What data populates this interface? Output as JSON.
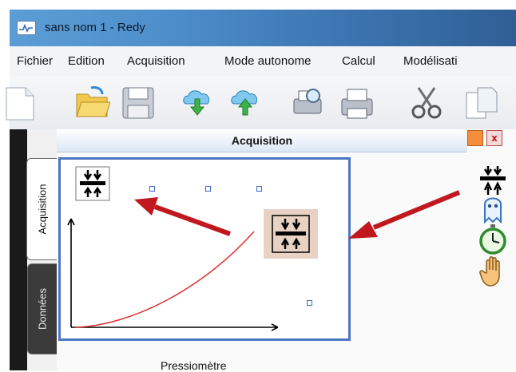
{
  "window": {
    "title": "sans nom 1 - Redy"
  },
  "menu": [
    "Fichier",
    "Edition",
    "Acquisition",
    "Mode autonome",
    "Calcul",
    "Modélisati"
  ],
  "toolbar": {
    "buttons": [
      "new-icon",
      "open-icon",
      "save-icon",
      "download-icon",
      "upload-icon",
      "print-preview-icon",
      "print-icon",
      "cut-icon",
      "copy-icon"
    ]
  },
  "side_tabs": {
    "acquisition": "Acquisition",
    "donnees": "Données"
  },
  "panel": {
    "title": "Acquisition",
    "close_label": "x",
    "caption": "Pressiomètre"
  },
  "palette": [
    "pressure-sensor-icon",
    "ghost-icon",
    "stopwatch-icon",
    "hand-icon"
  ],
  "colors": {
    "accent": "#4d76c2",
    "arrow": "#c0181e",
    "curve": "#e03030",
    "sensor_bg": "#e7d2c3"
  }
}
